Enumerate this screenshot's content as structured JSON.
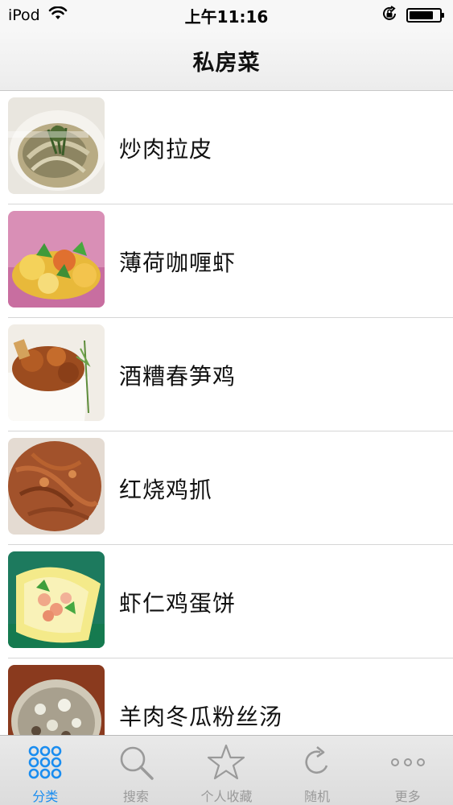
{
  "status_bar": {
    "carrier": "iPod",
    "time": "上午11:16",
    "battery_level": 0.8
  },
  "nav": {
    "title": "私房菜"
  },
  "recipes": [
    {
      "title": "炒肉拉皮"
    },
    {
      "title": "薄荷咖喱虾"
    },
    {
      "title": "酒糟春笋鸡"
    },
    {
      "title": "红烧鸡抓"
    },
    {
      "title": "虾仁鸡蛋饼"
    },
    {
      "title": "羊肉冬瓜粉丝汤"
    }
  ],
  "tabs": [
    {
      "label": "分类",
      "icon": "grid-dots-icon",
      "active": true
    },
    {
      "label": "搜索",
      "icon": "search-icon",
      "active": false
    },
    {
      "label": "个人收藏",
      "icon": "star-icon",
      "active": false
    },
    {
      "label": "随机",
      "icon": "refresh-icon",
      "active": false
    },
    {
      "label": "更多",
      "icon": "more-dots-icon",
      "active": false
    }
  ],
  "colors": {
    "accent": "#1a8df0",
    "inactive": "#9a9a9a"
  }
}
